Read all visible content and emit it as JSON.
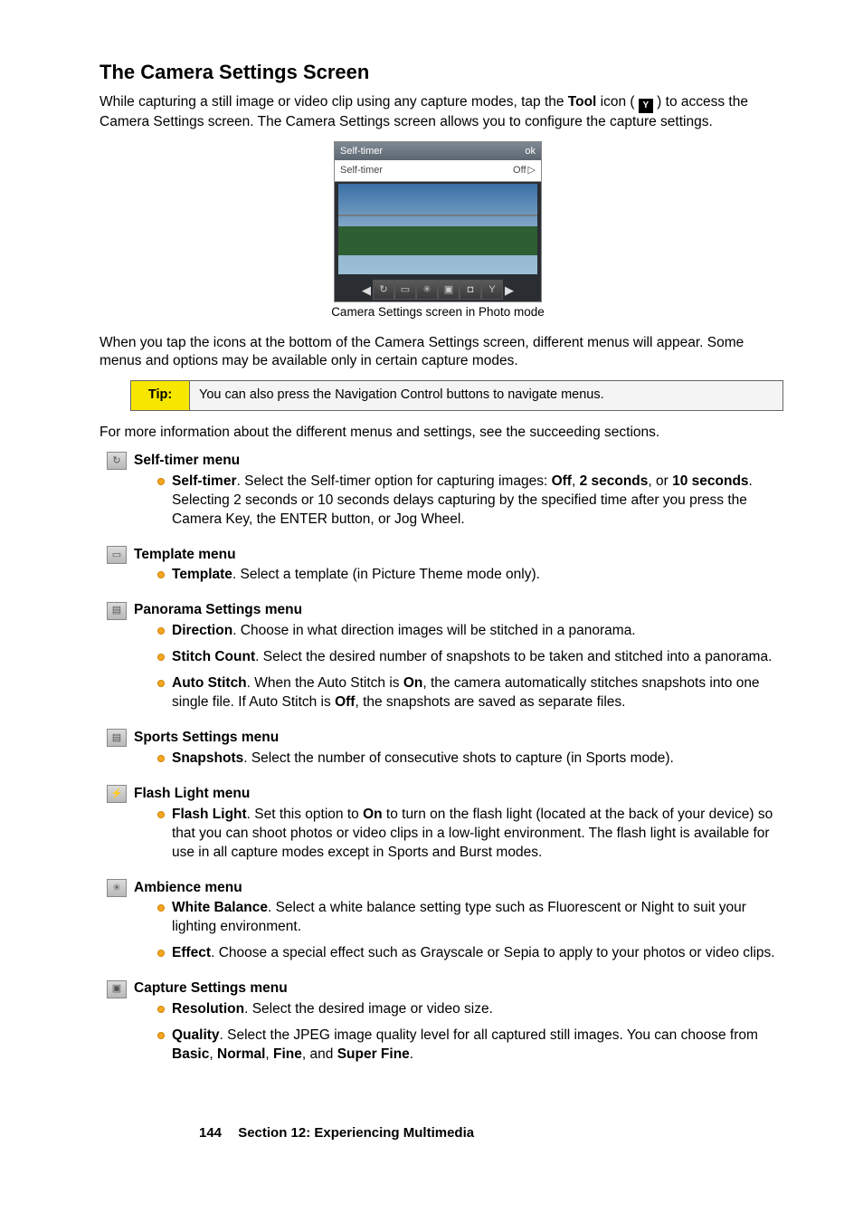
{
  "heading": "The Camera Settings Screen",
  "intro_a": "While capturing a still image or video clip using any capture modes, tap the ",
  "intro_tool": "Tool",
  "intro_b": " icon ( ",
  "intro_c": " ) to access the Camera Settings screen. The Camera Settings screen allows you to configure the capture settings.",
  "screenshot": {
    "title": "Self-timer",
    "ok": "ok",
    "row_label": "Self-timer",
    "row_value": "Off",
    "caption": "Camera Settings screen in Photo mode"
  },
  "para2": "When you tap the icons at the bottom of the Camera Settings screen, different menus will appear. Some menus and options may be available only in certain capture modes.",
  "tip_label": "Tip:",
  "tip_body": "You can also press the Navigation Control buttons to navigate menus.",
  "para3": "For more information about the different menus and settings, see the succeeding sections.",
  "menus": {
    "selftimer": {
      "title": "Self-timer menu",
      "item1_lead": "Self-timer",
      "item1_a": ". Select the Self-timer option for capturing images: ",
      "item1_off": "Off",
      "item1_b": ", ",
      "item1_2s": "2 seconds",
      "item1_c": ", or ",
      "item1_10s": "10 seconds",
      "item1_d": ". Selecting 2 seconds or 10 seconds delays capturing by the specified time after you press the Camera Key, the ENTER button, or Jog Wheel."
    },
    "template": {
      "title": "Template menu",
      "item1_lead": "Template",
      "item1_a": ". Select a template (in Picture Theme mode only)."
    },
    "panorama": {
      "title": "Panorama Settings menu",
      "dir_lead": "Direction",
      "dir_a": ". Choose in what direction images will be stitched in a panorama.",
      "stitch_lead": "Stitch Count",
      "stitch_a": ". Select the desired number of snapshots to be taken and stitched into a panorama.",
      "auto_lead": "Auto Stitch",
      "auto_a": ". When the Auto Stitch is ",
      "auto_on": "On",
      "auto_b": ", the camera automatically stitches snapshots into one single file. If Auto Stitch is ",
      "auto_off": "Off",
      "auto_c": ", the snapshots are saved as separate files."
    },
    "sports": {
      "title": "Sports Settings menu",
      "item1_lead": "Snapshots",
      "item1_a": ". Select the number of consecutive shots to capture (in Sports mode)."
    },
    "flash": {
      "title": "Flash Light menu",
      "item1_lead": "Flash Light",
      "item1_a": ". Set this option to ",
      "item1_on": "On",
      "item1_b": " to turn on the flash light (located at the back of your device) so that you can shoot photos or video clips in a low-light environment. The flash light is available for use in all capture modes except in Sports and Burst modes."
    },
    "ambience": {
      "title": "Ambience menu",
      "wb_lead": "White Balance",
      "wb_a": ". Select a white balance setting type such as Fluorescent or Night to suit your lighting environment.",
      "fx_lead": "Effect",
      "fx_a": ". Choose a special effect such as Grayscale or Sepia to apply to your photos or video clips."
    },
    "capture": {
      "title": "Capture Settings menu",
      "res_lead": "Resolution",
      "res_a": ". Select the desired image or video size.",
      "q_lead": "Quality",
      "q_a": ". Select the JPEG image quality level for all captured still images. You can choose from ",
      "q_basic": "Basic",
      "q_b": ", ",
      "q_normal": "Normal",
      "q_c": ", ",
      "q_fine": "Fine",
      "q_d": ", and ",
      "q_super": "Super Fine",
      "q_e": "."
    }
  },
  "footer": {
    "page": "144",
    "section": "Section 12: Experiencing Multimedia"
  }
}
